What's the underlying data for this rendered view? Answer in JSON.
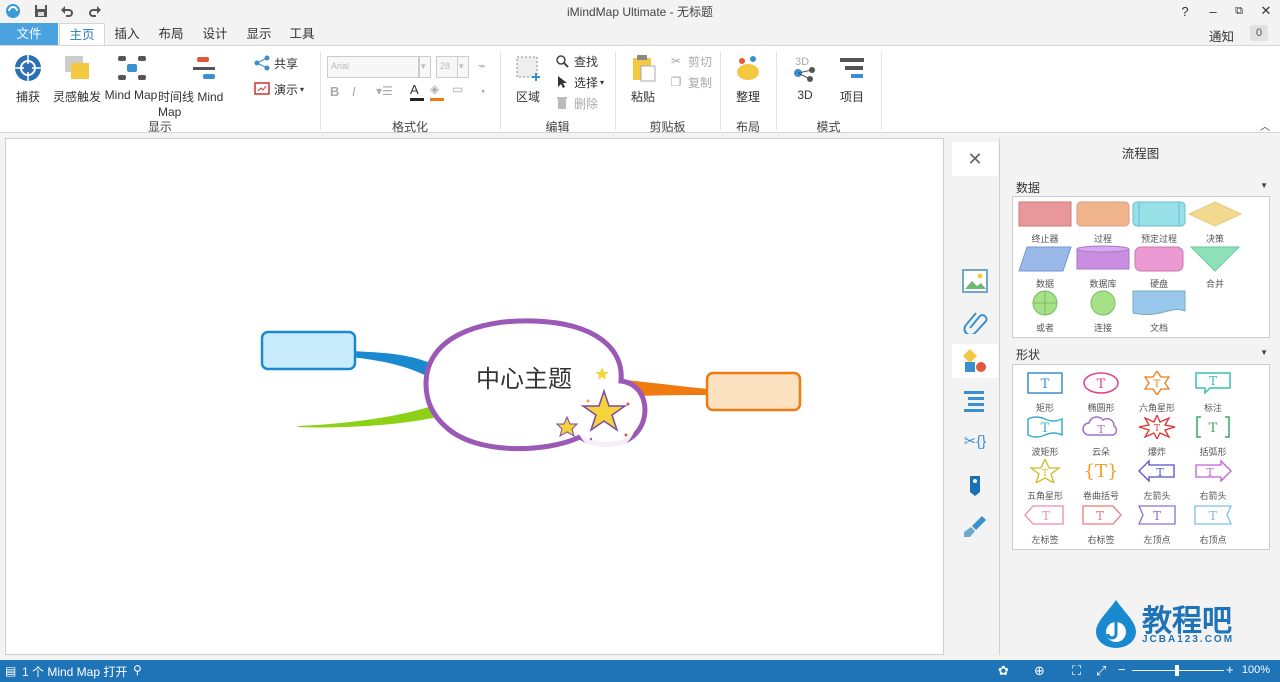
{
  "window": {
    "title": "iMindMap Ultimate - 无标题",
    "help": "?",
    "min": "–",
    "restore": "⧉",
    "close": "✕"
  },
  "tabs": [
    {
      "label": "文件"
    },
    {
      "label": "主页"
    },
    {
      "label": "插入"
    },
    {
      "label": "布局"
    },
    {
      "label": "设计"
    },
    {
      "label": "显示"
    },
    {
      "label": "工具"
    }
  ],
  "notify": {
    "label": "通知",
    "count": "0"
  },
  "ribbon": {
    "display": {
      "label": "显示",
      "capture": "捕获",
      "brainstorm": "灵感触发",
      "mindmap": "Mind Map",
      "timeline": "时间线 Mind Map",
      "share": "共享",
      "present": "演示"
    },
    "format": {
      "label": "格式化",
      "font": "Arial",
      "size": "28"
    },
    "edit": {
      "label": "编辑",
      "region": "区域",
      "find": "查找",
      "select": "选择",
      "delete": "删除"
    },
    "clipboard": {
      "label": "剪贴板",
      "paste": "粘贴",
      "cut": "剪切",
      "copy": "复制"
    },
    "layout": {
      "label": "布局",
      "arrange": "整理"
    },
    "mode": {
      "label": "模式",
      "three_d": "3D",
      "project": "项目"
    }
  },
  "mindmap": {
    "central_topic": "中心主题"
  },
  "panel": {
    "title": "流程图",
    "data_section": {
      "title": "数据",
      "items": [
        "终止器",
        "过程",
        "预定过程",
        "决策",
        "数据",
        "数据库",
        "硬盘",
        "合并",
        "或者",
        "连接",
        "文档"
      ]
    },
    "shape_section": {
      "title": "形状",
      "items": [
        "矩形",
        "椭圆形",
        "六角星形",
        "标注",
        "波矩形",
        "云朵",
        "爆炸",
        "括弧形",
        "五角星形",
        "卷曲括号",
        "左箭头",
        "右箭头",
        "左标签",
        "右标签",
        "左顶点",
        "右顶点"
      ]
    }
  },
  "watermark": {
    "text": "教程吧",
    "sub": "JCBA123.COM"
  },
  "status": {
    "text": "1 个 Mind Map 打开",
    "zoom": "100%"
  },
  "colors": {
    "ribbon_file_tab": "#4aa3df",
    "status_bar": "#1f73b7",
    "central_outline": "#9b59b6",
    "branch_blue": "#1a8ad0",
    "branch_green": "#8cd017",
    "branch_orange": "#f07a12"
  }
}
